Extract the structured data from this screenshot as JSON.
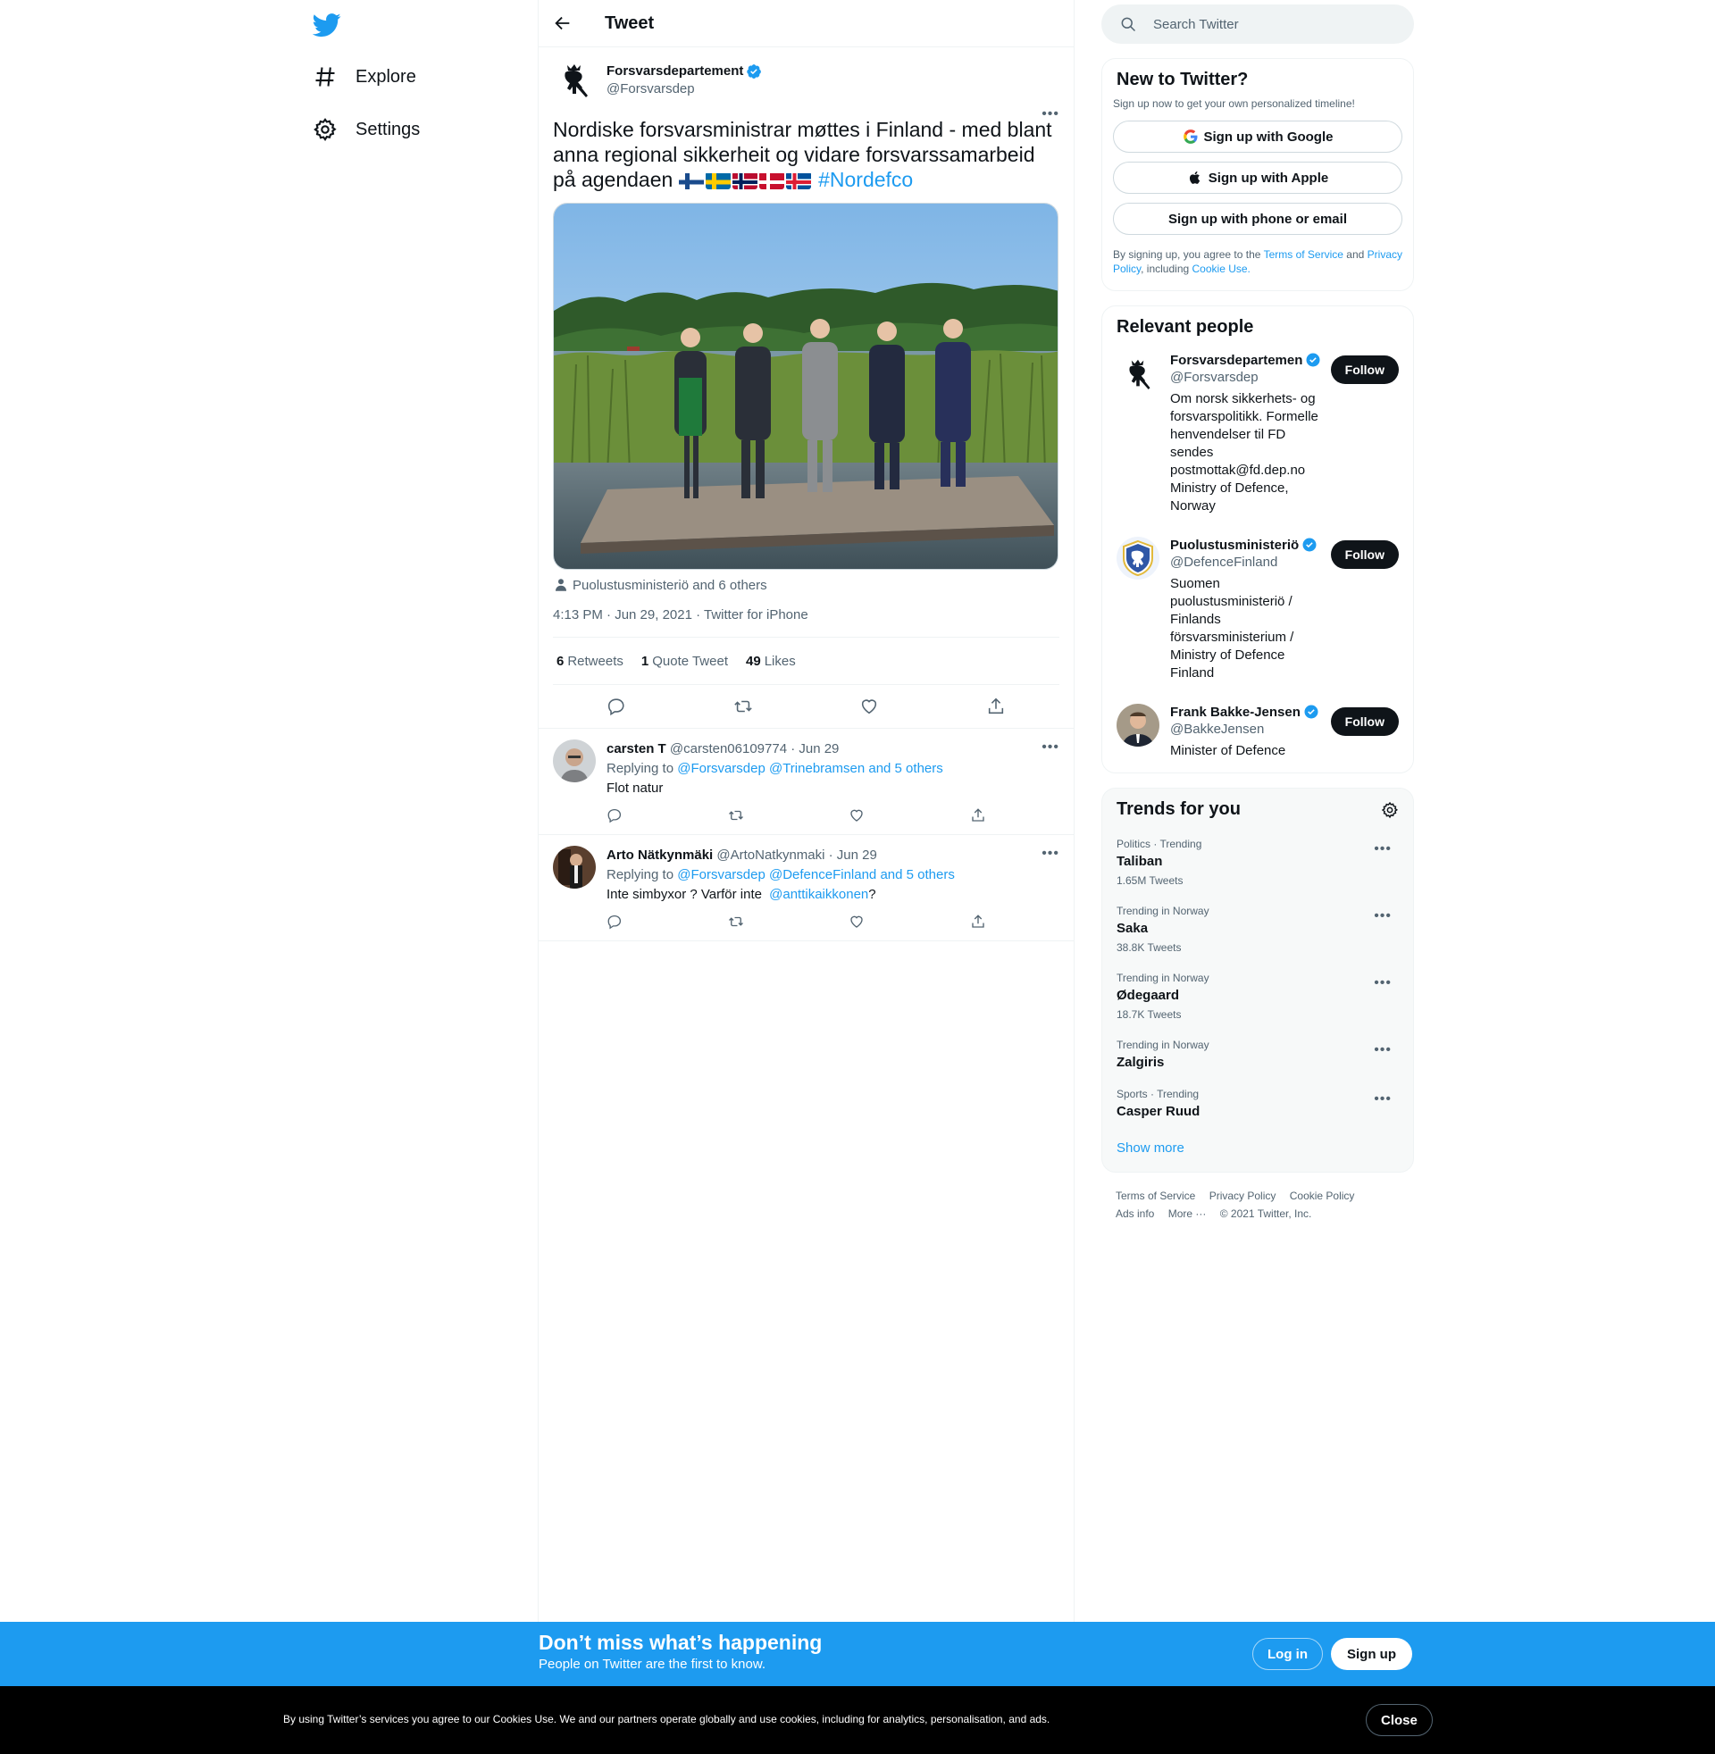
{
  "colors": {
    "brand": "#1d9bf0",
    "text": "#0f1419",
    "muted": "#536471"
  },
  "nav": {
    "logo_icon": "twitter-bird-icon",
    "items": [
      {
        "label": "Explore",
        "icon": "hashtag-icon"
      },
      {
        "label": "Settings",
        "icon": "gear-icon"
      }
    ]
  },
  "header": {
    "title": "Tweet"
  },
  "tweet": {
    "author_name": "Forsvarsdepartement",
    "author_handle": "@Forsvarsdep",
    "text": "Nordiske forsvarsministrar møttes i Finland - med blant anna regional sikkerheit og vidare forsvarssamarbeid på agendaen",
    "hashtag": "#Nordefco",
    "tagged": "Puolustusministeriö and 6 others",
    "timestamp": "4:13 PM · Jun 29, 2021 · Twitter for iPhone",
    "retweets": "6",
    "retweets_label": "Retweets",
    "quotes": "1",
    "quotes_label": "Quote Tweet",
    "likes": "49",
    "likes_label": "Likes"
  },
  "replies": [
    {
      "name": "carsten T",
      "handle": "@carsten06109774",
      "date": "· Jun 29",
      "replying_label": "Replying to",
      "mentions": "@Forsvarsdep @Trinebramsen and 5 others",
      "text": "Flot natur"
    },
    {
      "name": "Arto Nätkynmäki",
      "handle": "@ArtoNatkynmaki",
      "date": "· Jun 29",
      "replying_label": "Replying to",
      "mentions": "@Forsvarsdep @DefenceFinland and 5 others",
      "text": "Inte simbyxor ? Varför inte",
      "text_mention": "@anttikaikkonen",
      "text_end": "?"
    }
  ],
  "search": {
    "placeholder": "Search Twitter"
  },
  "new_to_twitter": {
    "title": "New to Twitter?",
    "subtitle": "Sign up now to get your own personalized timeline!",
    "google": "Sign up with Google",
    "apple": "Sign up with Apple",
    "phone": "Sign up with phone or email",
    "legal_1": "By signing up, you agree to the",
    "terms": "Terms of Service",
    "legal_2": "and",
    "privacy": "Privacy Policy",
    "legal_3": ", including",
    "cookie": "Cookie Use."
  },
  "relevant": {
    "title": "Relevant people",
    "follow_label": "Follow",
    "people": [
      {
        "name": "Forsvarsdepartemen",
        "handle": "@Forsvarsdep",
        "bio": "Om norsk sikkerhets- og forsvarspolitikk. Formelle henvendelser til FD sendes postmottak@fd.dep.no Ministry of Defence, Norway"
      },
      {
        "name": "Puolustusministeriö",
        "handle": "@DefenceFinland",
        "bio": "Suomen puolustusministeriö / Finlands försvarsministerium / Ministry of Defence Finland"
      },
      {
        "name": "Frank Bakke-Jensen",
        "handle": "@BakkeJensen",
        "bio": "Minister of Defence"
      }
    ]
  },
  "trends": {
    "title": "Trends for you",
    "items": [
      {
        "category": "Politics · Trending",
        "name": "Taliban",
        "count": "1.65M Tweets"
      },
      {
        "category": "Trending in Norway",
        "name": "Saka",
        "count": "38.8K Tweets"
      },
      {
        "category": "Trending in Norway",
        "name": "Ødegaard",
        "count": "18.7K Tweets"
      },
      {
        "category": "Trending in Norway",
        "name": "Zalgiris",
        "count": ""
      },
      {
        "category": "Sports · Trending",
        "name": "Casper Ruud",
        "count": ""
      }
    ],
    "show_more": "Show more"
  },
  "footer": {
    "terms": "Terms of Service",
    "privacy": "Privacy Policy",
    "cookie": "Cookie Policy",
    "ads": "Ads info",
    "more": "More ···",
    "copyright": "© 2021 Twitter, Inc."
  },
  "banner": {
    "title": "Don’t miss what’s happening",
    "subtitle": "People on Twitter are the first to know.",
    "login": "Log in",
    "signup": "Sign up"
  },
  "cookie_bar": {
    "text": "By using Twitter’s services you agree to our Cookies Use. We and our partners operate globally and use cookies, including for analytics, personalisation, and ads.",
    "close": "Close"
  }
}
